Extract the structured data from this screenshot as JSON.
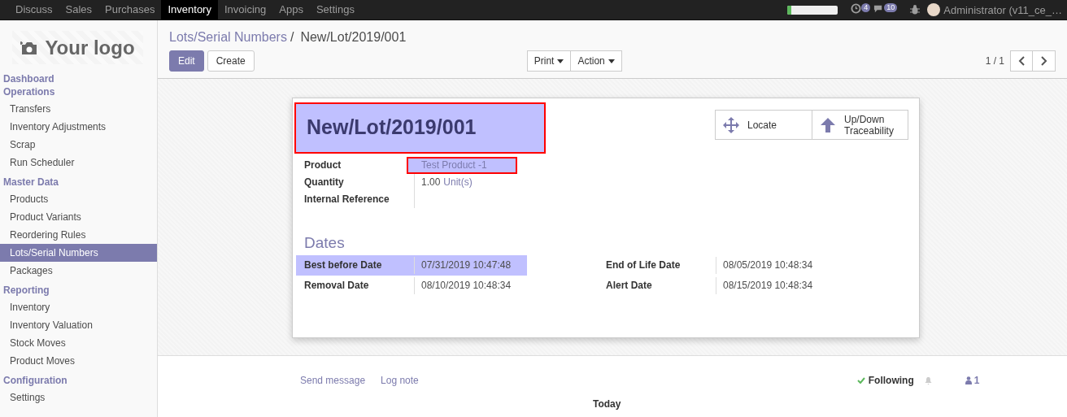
{
  "top_menu": [
    {
      "label": "Discuss",
      "selected": false
    },
    {
      "label": "Sales",
      "selected": false
    },
    {
      "label": "Purchases",
      "selected": false
    },
    {
      "label": "Inventory",
      "selected": true
    },
    {
      "label": "Invoicing",
      "selected": false
    },
    {
      "label": "Apps",
      "selected": false
    },
    {
      "label": "Settings",
      "selected": false
    }
  ],
  "systray": {
    "progress": {
      "level": 0.08
    },
    "activity_count": "4",
    "message_count": "10",
    "user": "Administrator (v11_ce_…"
  },
  "sidebar": {
    "logo": "Your logo",
    "sections": [
      {
        "title": "Dashboard"
      },
      {
        "title": "Operations",
        "items": [
          {
            "label": "Transfers",
            "selected": false
          },
          {
            "label": "Inventory Adjustments",
            "selected": false
          },
          {
            "label": "Scrap",
            "selected": false
          },
          {
            "label": "Run Scheduler",
            "selected": false
          }
        ]
      },
      {
        "title": "Master Data",
        "items": [
          {
            "label": "Products",
            "selected": false
          },
          {
            "label": "Product Variants",
            "selected": false
          },
          {
            "label": "Reordering Rules",
            "selected": false
          },
          {
            "label": "Lots/Serial Numbers",
            "selected": true
          },
          {
            "label": "Packages",
            "selected": false
          }
        ]
      },
      {
        "title": "Reporting",
        "items": [
          {
            "label": "Inventory",
            "selected": false
          },
          {
            "label": "Inventory Valuation",
            "selected": false
          },
          {
            "label": "Stock Moves",
            "selected": false
          },
          {
            "label": "Product Moves",
            "selected": false
          }
        ]
      },
      {
        "title": "Configuration",
        "items": [
          {
            "label": "Settings",
            "selected": false
          }
        ]
      }
    ]
  },
  "control_panel": {
    "breadcrumb": [
      {
        "label": "Lots/Serial Numbers",
        "kind": "link"
      },
      {
        "label": "/",
        "kind": "separator"
      },
      {
        "label": "New/Lot/2019/001",
        "kind": "current"
      }
    ],
    "buttons": [
      {
        "label": "Edit",
        "kind": "primary"
      },
      {
        "label": "Create",
        "kind": "secondary"
      }
    ],
    "dropdowns": [
      {
        "label": "Print"
      },
      {
        "label": "Action"
      }
    ],
    "pager": "1 / 1"
  },
  "form": {
    "title": "New/Lot/2019/001",
    "title_highlighted": true,
    "smart_buttons": [
      {
        "label": "Locate",
        "kind": "move"
      },
      {
        "label": "Up/Down Traceability",
        "kind": "arrow"
      }
    ],
    "fields": [
      {
        "label": "Product",
        "kind": "link",
        "value": "Test Product -1",
        "highlighted": true
      },
      {
        "label": "Quantity",
        "kind": "quantity",
        "value": "1.00",
        "unit": "Unit(s)",
        "highlighted": false
      },
      {
        "label": "Internal Reference",
        "kind": "empty",
        "highlighted": false
      }
    ],
    "dates_title": "Dates",
    "dates_left": [
      {
        "label": "Best before Date",
        "value": "07/31/2019 10:47:48",
        "highlighted": true
      },
      {
        "label": "Removal Date",
        "value": "08/10/2019 10:48:34",
        "highlighted": false
      }
    ],
    "dates_right": [
      {
        "label": "End of Life Date",
        "value": "08/05/2019 10:48:34",
        "highlighted": false
      },
      {
        "label": "Alert Date",
        "value": "08/15/2019 10:48:34",
        "highlighted": false
      }
    ]
  },
  "chatter": {
    "send_message": "Send message",
    "log_note": "Log note",
    "following": "Following",
    "followers": "1",
    "today": "Today"
  }
}
